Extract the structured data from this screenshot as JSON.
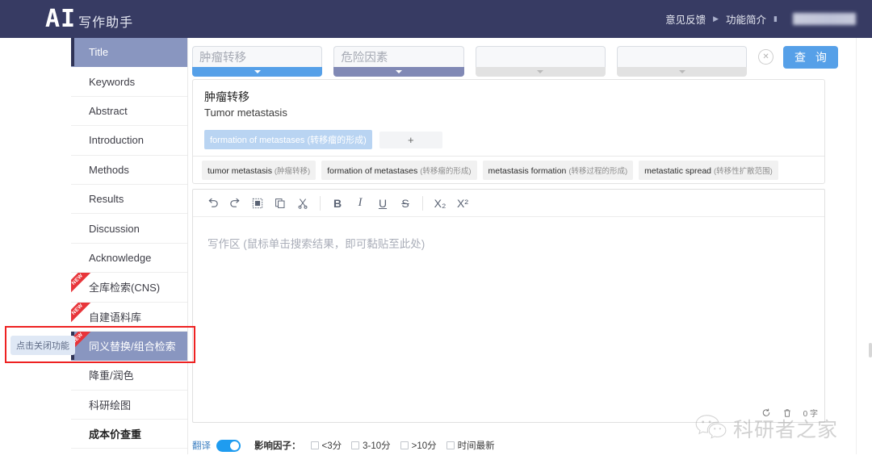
{
  "header": {
    "logo_main": "AI",
    "logo_sub": "写作助手",
    "links": [
      {
        "label": "意见反馈",
        "icon": "chevron-right-icon"
      },
      {
        "label": "功能简介",
        "icon": "chevron-right-icon"
      }
    ],
    "user_area": "blurred-user-name"
  },
  "sidebar": {
    "items": [
      {
        "label": "Title",
        "active": true,
        "badge": "",
        "bold": false
      },
      {
        "label": "Keywords",
        "active": false,
        "badge": "",
        "bold": false
      },
      {
        "label": "Abstract",
        "active": false,
        "badge": "",
        "bold": false
      },
      {
        "label": "Introduction",
        "active": false,
        "badge": "",
        "bold": false
      },
      {
        "label": "Methods",
        "active": false,
        "badge": "",
        "bold": false
      },
      {
        "label": "Results",
        "active": false,
        "badge": "",
        "bold": false
      },
      {
        "label": "Discussion",
        "active": false,
        "badge": "",
        "bold": false
      },
      {
        "label": "Acknowledge",
        "active": false,
        "badge": "",
        "bold": false
      },
      {
        "label": "全库检索(CNS)",
        "active": false,
        "badge": "NEW",
        "bold": false
      },
      {
        "label": "自建语料库",
        "active": false,
        "badge": "NEW",
        "bold": false
      },
      {
        "label": "同义替换/组合检索",
        "active": true,
        "badge": "NEW",
        "bold": false
      },
      {
        "label": "降重/润色",
        "active": false,
        "badge": "",
        "bold": false
      },
      {
        "label": "科研绘图",
        "active": false,
        "badge": "",
        "bold": false
      },
      {
        "label": "成本价查重",
        "active": false,
        "badge": "",
        "bold": true
      }
    ],
    "tooltip": "点击关闭功能"
  },
  "search": {
    "fields": [
      {
        "value": "肿瘤转移",
        "placeholder": "",
        "bar": "active"
      },
      {
        "value": "危险因素",
        "placeholder": "",
        "bar": "secondary"
      },
      {
        "value": "",
        "placeholder": "",
        "bar": "empty"
      },
      {
        "value": "",
        "placeholder": "",
        "bar": "empty"
      }
    ],
    "clear_icon": "close-circle-icon",
    "query_label": "查 询"
  },
  "result": {
    "title_cn": "肿瘤转移",
    "title_en": "Tumor metastasis",
    "selected_tag": "formation of metastases (转移瘤的形成)",
    "add_label": "+",
    "chips": [
      {
        "en": "tumor metastasis",
        "cn": "(肿瘤转移)"
      },
      {
        "en": "formation of metastases",
        "cn": "(转移瘤的形成)"
      },
      {
        "en": "metastasis formation",
        "cn": "(转移过程的形成)"
      },
      {
        "en": "metastatic spread",
        "cn": "(转移性扩散范围)"
      }
    ]
  },
  "editor": {
    "toolbar": [
      {
        "name": "undo-icon",
        "label": "↶"
      },
      {
        "name": "redo-icon",
        "label": "↷"
      },
      {
        "name": "select-all-icon",
        "label": "▨"
      },
      {
        "name": "copy-icon",
        "label": "⧉"
      },
      {
        "name": "cut-icon",
        "label": "✂"
      },
      {
        "name": "bold-icon",
        "label": "B"
      },
      {
        "name": "italic-icon",
        "label": "I"
      },
      {
        "name": "underline-icon",
        "label": "U"
      },
      {
        "name": "strikethrough-icon",
        "label": "S"
      },
      {
        "name": "subscript-icon",
        "label": "X₂"
      },
      {
        "name": "superscript-icon",
        "label": "X²"
      }
    ],
    "placeholder": "写作区 (鼠标单击搜索结果，即可黏贴至此处)",
    "status": {
      "sync_icon": "refresh-icon",
      "delete_icon": "trash-icon",
      "word_count": "0 字"
    }
  },
  "bottombar": {
    "translate_label": "翻译",
    "translate_on": true,
    "impact_label": "影响因子：",
    "checkboxes": [
      {
        "label": "<3分",
        "checked": false
      },
      {
        "label": "3-10分",
        "checked": false
      },
      {
        "label": ">10分",
        "checked": false
      },
      {
        "label": "时间最新",
        "checked": false
      }
    ]
  },
  "watermark": {
    "text": "科研者之家",
    "icon": "wechat-icon"
  },
  "colors": {
    "header_bg": "#373b63",
    "accent_blue": "#56a0e8",
    "sidebar_active": "#8996c0",
    "badge_red": "#e8353a",
    "annotation_red": "#ee2222"
  }
}
